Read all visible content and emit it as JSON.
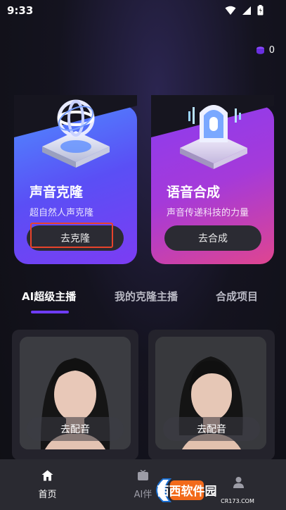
{
  "status_bar": {
    "time": "9:33"
  },
  "coins": {
    "count": "0"
  },
  "cards": [
    {
      "title": "声音克隆",
      "subtitle": "超自然人声克隆",
      "button": "去克隆"
    },
    {
      "title": "语音合成",
      "subtitle": "声音传递科技的力量",
      "button": "去合成"
    }
  ],
  "tabs": [
    {
      "label": "AI超级主播",
      "active": true
    },
    {
      "label": "我的克隆主播",
      "active": false
    },
    {
      "label": "合成项目",
      "active": false
    }
  ],
  "voices": [
    {
      "button": "去配音"
    },
    {
      "button": "去配音"
    }
  ],
  "bottom_nav": [
    {
      "label": "首页",
      "icon": "home-icon",
      "active": true
    },
    {
      "label": "AI伴",
      "icon": "tv-icon",
      "active": false
    },
    {
      "label": "",
      "icon": "profile-icon",
      "active": false
    }
  ],
  "watermark": {
    "text": "西西软件园",
    "sub": "CR173.COM"
  },
  "colors": {
    "accent": "#6e3cf5",
    "highlight_box": "#e8432b"
  }
}
